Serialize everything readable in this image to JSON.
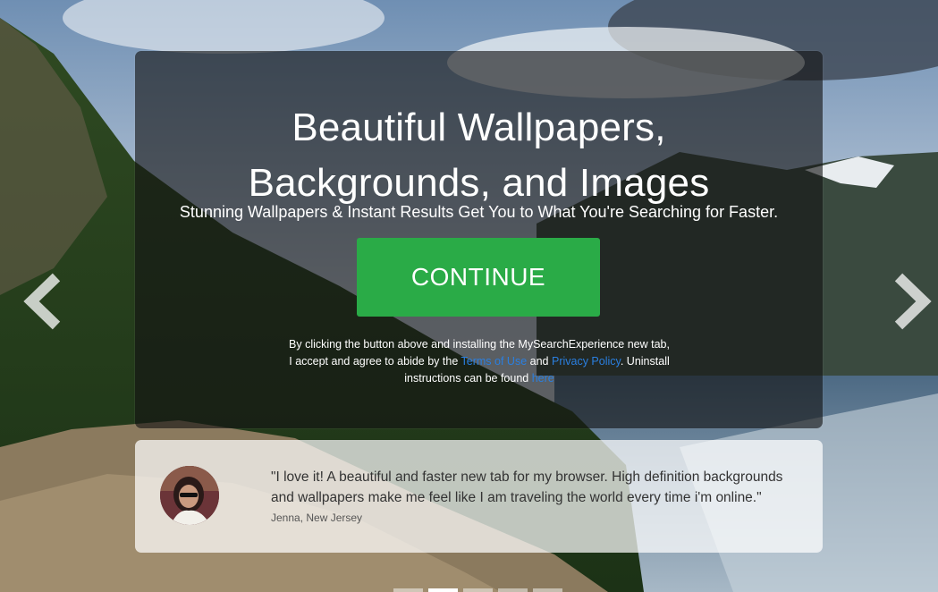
{
  "hero": {
    "title_line1": "Beautiful Wallpapers,",
    "title_line2": "Backgrounds, and Images",
    "subtitle": "Stunning Wallpapers & Instant Results Get You to What You're Searching for Faster.",
    "cta_label": "CONTINUE",
    "cta_color": "#2aab47"
  },
  "legal": {
    "text1": "By clicking the button above and installing the MySearchExperience new tab, I accept and agree to abide by the ",
    "terms_link": "Terms of Use",
    "and": " and ",
    "privacy_link": "Privacy Policy",
    "text2": ". Uninstall instructions can be found ",
    "here_link": "here",
    "link_color": "#2a7fe0"
  },
  "testimonial": {
    "quote": "\"I love it! A beautiful and faster new tab for my browser. High definition backgrounds and wallpapers make me feel like I am traveling the world every time i'm online.\"",
    "author": "Jenna, New Jersey"
  },
  "carousel": {
    "prev_icon": "chevron-left-icon",
    "next_icon": "chevron-right-icon",
    "slide_count": 5,
    "active_index": 1
  }
}
